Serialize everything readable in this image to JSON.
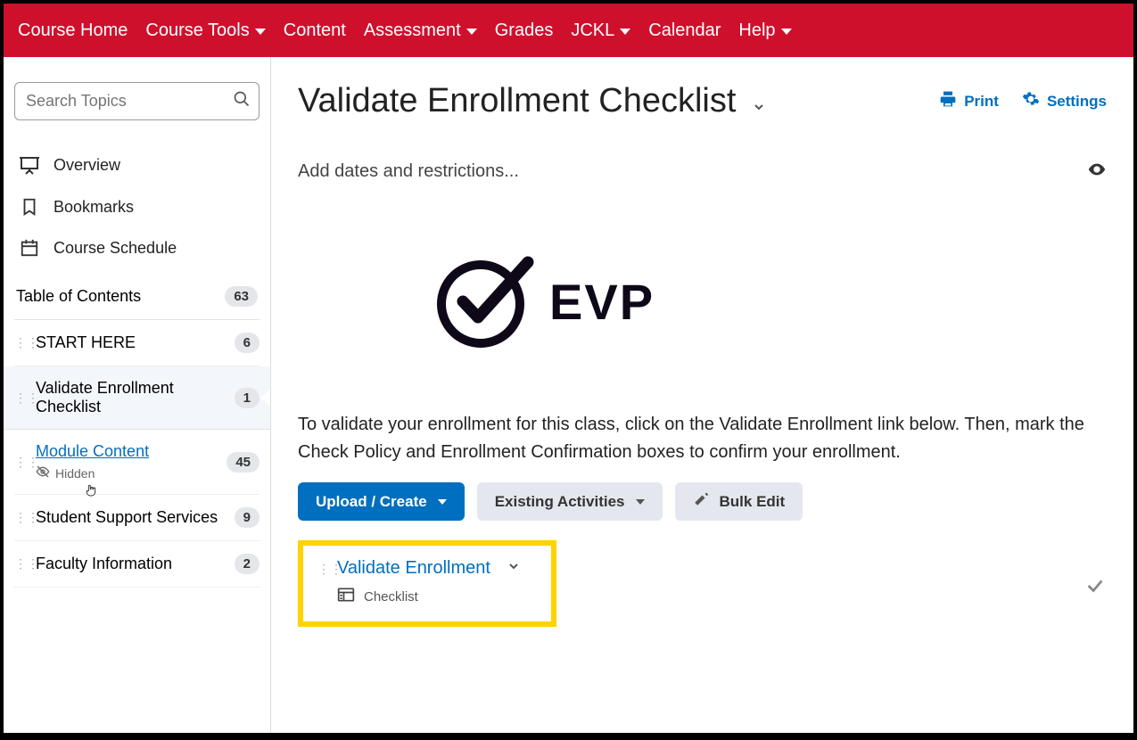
{
  "nav": {
    "items": [
      {
        "label": "Course Home",
        "dropdown": false
      },
      {
        "label": "Course Tools",
        "dropdown": true
      },
      {
        "label": "Content",
        "dropdown": false
      },
      {
        "label": "Assessment",
        "dropdown": true
      },
      {
        "label": "Grades",
        "dropdown": false
      },
      {
        "label": "JCKL",
        "dropdown": true
      },
      {
        "label": "Calendar",
        "dropdown": false
      },
      {
        "label": "Help",
        "dropdown": true
      }
    ]
  },
  "sidebar": {
    "search_placeholder": "Search Topics",
    "links": {
      "overview": "Overview",
      "bookmarks": "Bookmarks",
      "schedule": "Course Schedule"
    },
    "toc_label": "Table of Contents",
    "toc_count": "63",
    "items": [
      {
        "label": "START HERE",
        "count": "6"
      },
      {
        "label": "Validate Enrollment Checklist",
        "count": "1"
      },
      {
        "label": "Module Content",
        "count": "45",
        "hidden_label": "Hidden"
      },
      {
        "label": "Student Support Services",
        "count": "9"
      },
      {
        "label": "Faculty Information",
        "count": "2"
      }
    ]
  },
  "main": {
    "title": "Validate Enrollment Checklist",
    "print": "Print",
    "settings": "Settings",
    "subtext": "Add dates and restrictions...",
    "logo_text": "EVP",
    "description": "To validate your enrollment for this class, click on the Validate Enrollment link below. Then, mark the Check Policy and Enrollment Confirmation boxes to confirm your enrollment.",
    "buttons": {
      "upload": "Upload / Create",
      "existing": "Existing Activities",
      "bulk": "Bulk Edit"
    },
    "checklist_item": {
      "title": "Validate Enrollment",
      "type": "Checklist"
    }
  }
}
